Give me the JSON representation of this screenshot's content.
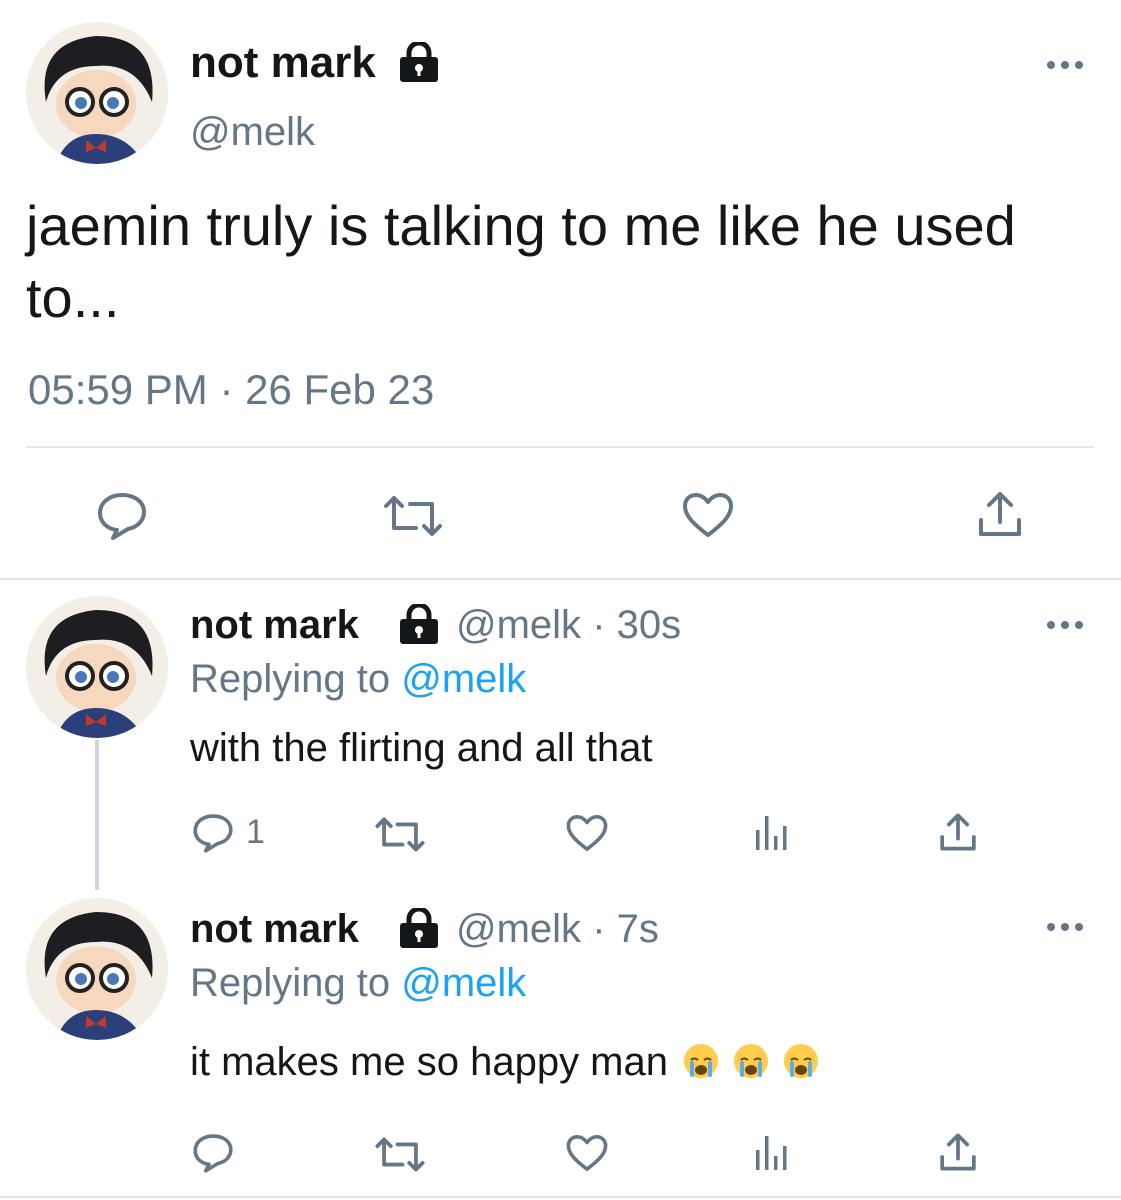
{
  "main_tweet": {
    "display_name": "not mark",
    "handle": "@melk",
    "text": "jaemin truly is talking to me like he used to...",
    "timestamp": "05:59 PM · 26 Feb 23",
    "more_icon": "more-dots-icon",
    "lock_icon": "lock-icon"
  },
  "replies": [
    {
      "display_name": "not mark",
      "handle": "@melk",
      "age": "· 30s",
      "replying_label": "Replying to",
      "replying_to": "@melk",
      "text": "with the flirting and all that",
      "reply_count": "1"
    },
    {
      "display_name": "not mark",
      "handle": "@melk",
      "age": "· 7s",
      "replying_label": "Replying to",
      "replying_to": "@melk",
      "text": "it makes me so happy man",
      "emojis": [
        "loudly-crying-face",
        "loudly-crying-face",
        "loudly-crying-face"
      ]
    }
  ],
  "colors": {
    "text": "#14171a",
    "secondary": "#657786",
    "link": "#1da1f2",
    "divider": "#e1e8ed",
    "thread_line": "#ccd6dd"
  }
}
